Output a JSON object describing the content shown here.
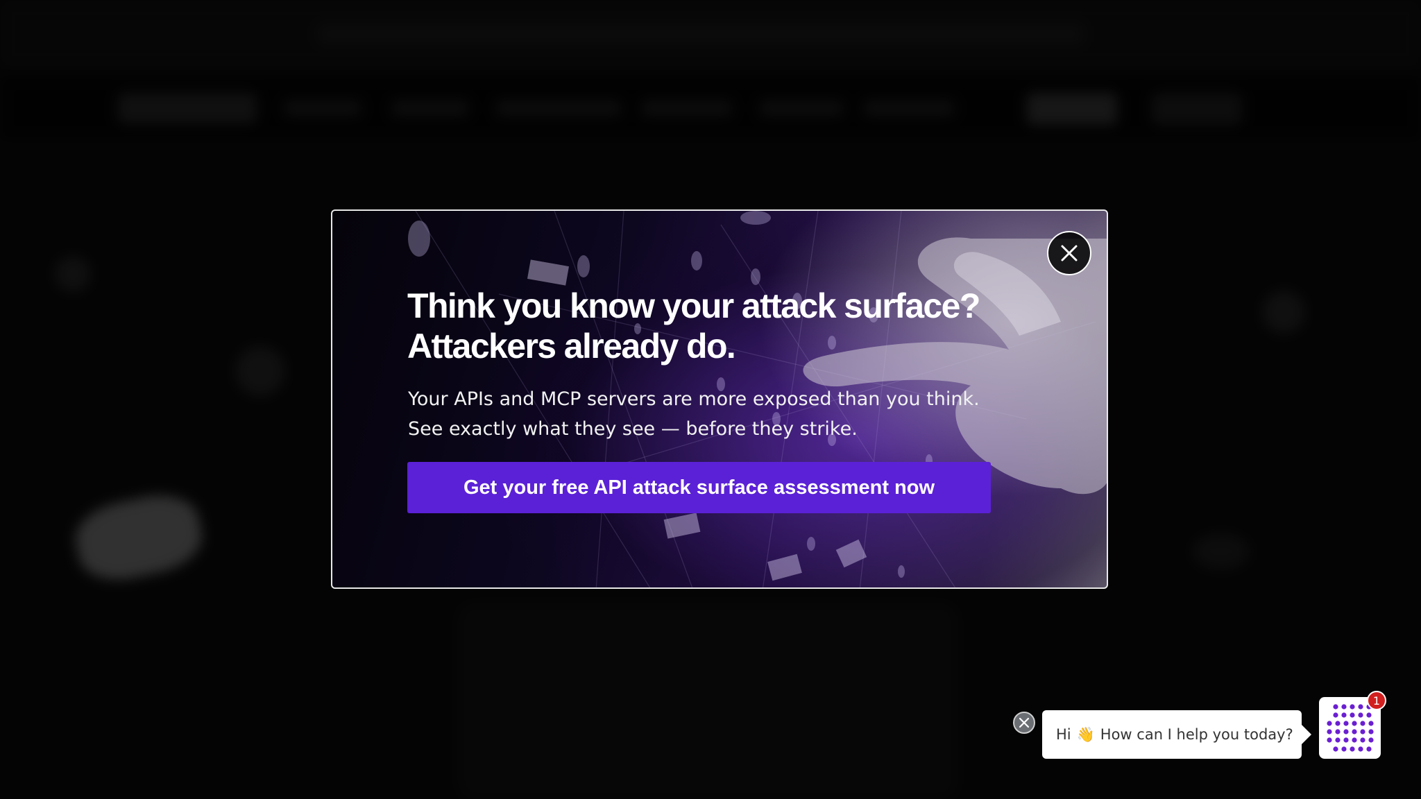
{
  "modal": {
    "headline_line1": "Think you know your attack surface?",
    "headline_line2": "Attackers already do.",
    "subtext_line1": "Your APIs and MCP servers are more exposed than you think.",
    "subtext_line2": "See exactly what they see — before they strike.",
    "cta_label": "Get your free API attack surface assessment now",
    "close_icon": "close-icon",
    "colors": {
      "cta": "#5b21d6",
      "border": "#e8e8e8"
    }
  },
  "chat": {
    "greeting_hi": "Hi",
    "greeting_emoji": "👋",
    "greeting_text": "How can I help you today?",
    "badge_count": "1",
    "launcher_icon": "dot-grid-icon",
    "dismiss_icon": "close-icon",
    "colors": {
      "badge": "#d21f1f",
      "dots": "#6a1fd1"
    }
  }
}
